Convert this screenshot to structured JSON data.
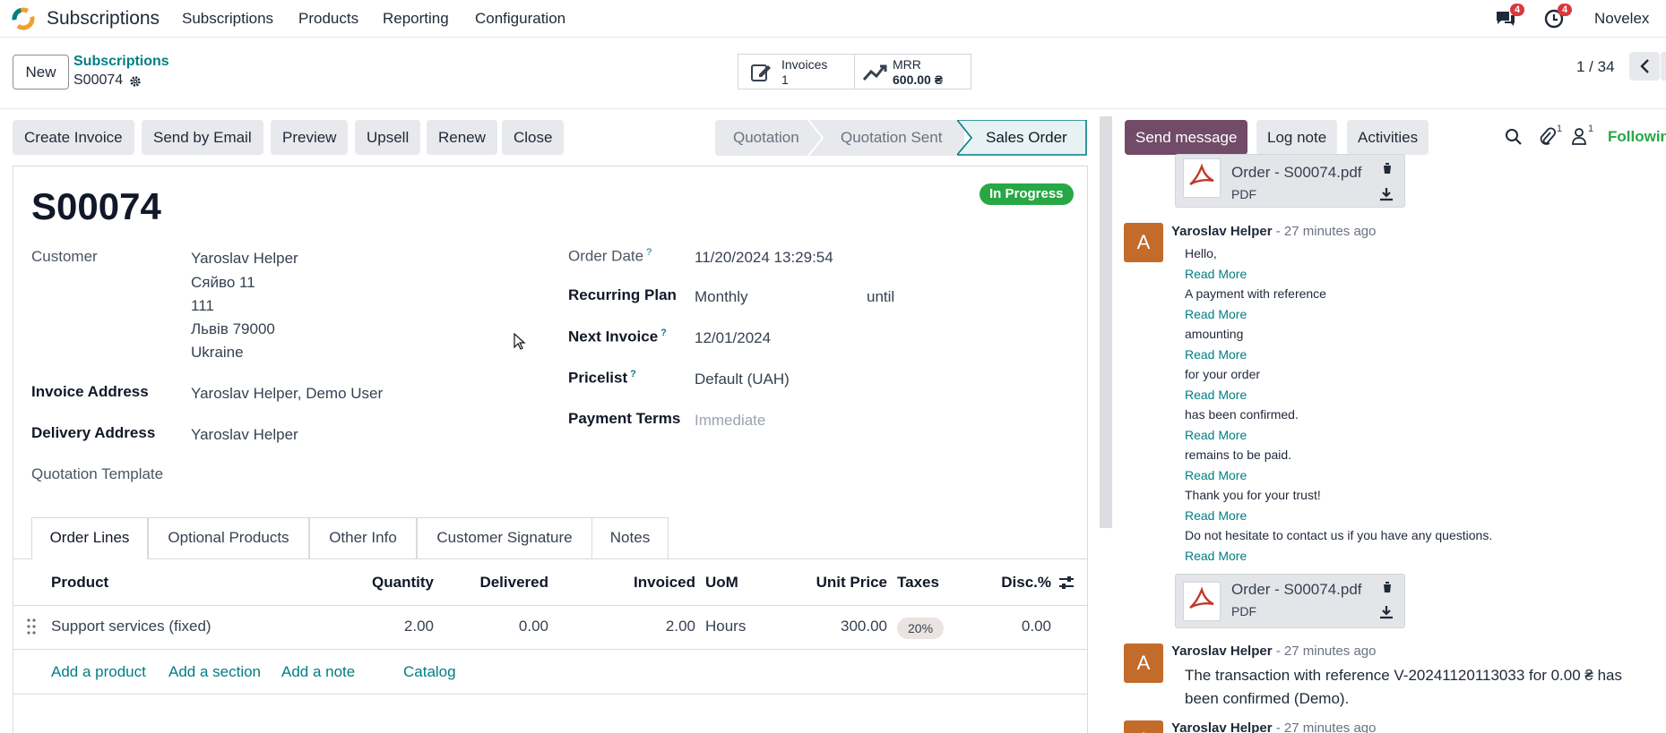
{
  "topbar": {
    "app_name": "Subscriptions",
    "menu": [
      "Subscriptions",
      "Products",
      "Reporting",
      "Configuration"
    ],
    "messages_badge": "4",
    "activities_badge": "4",
    "company": "Novelex"
  },
  "control": {
    "new_label": "New",
    "breadcrumb_parent": "Subscriptions",
    "record_name": "S00074",
    "invoices_label": "Invoices",
    "invoices_count": "1",
    "mrr_label": "MRR",
    "mrr_value": "600.00 ₴",
    "pager": "1 / 34"
  },
  "actions": [
    "Create Invoice",
    "Send by Email",
    "Preview",
    "Upsell",
    "Renew",
    "Close"
  ],
  "stages": [
    "Quotation",
    "Quotation Sent",
    "Sales Order"
  ],
  "form": {
    "title": "S00074",
    "status": "In Progress",
    "customer_label": "Customer",
    "customer_name": "Yaroslav Helper",
    "customer_address": [
      "Сяйво 11",
      "111",
      "Львів 79000",
      "Ukraine"
    ],
    "invoice_address_label": "Invoice Address",
    "invoice_address": "Yaroslav Helper, Demo User",
    "delivery_address_label": "Delivery Address",
    "delivery_address": "Yaroslav Helper",
    "quotation_template_label": "Quotation Template",
    "order_date_label": "Order Date",
    "order_date": "11/20/2024 13:29:54",
    "recurring_plan_label": "Recurring Plan",
    "recurring_plan": "Monthly",
    "until_label": "until",
    "next_invoice_label": "Next Invoice",
    "next_invoice": "12/01/2024",
    "pricelist_label": "Pricelist",
    "pricelist": "Default (UAH)",
    "payment_terms_label": "Payment Terms",
    "payment_terms": "Immediate",
    "qmark": "?"
  },
  "tabs": [
    "Order Lines",
    "Optional Products",
    "Other Info",
    "Customer Signature",
    "Notes"
  ],
  "table": {
    "headers": [
      "Product",
      "Quantity",
      "Delivered",
      "Invoiced",
      "UoM",
      "Unit Price",
      "Taxes",
      "Disc.%"
    ],
    "row": {
      "product": "Support services (fixed)",
      "quantity": "2.00",
      "delivered": "0.00",
      "invoiced": "2.00",
      "uom": "Hours",
      "unit_price": "300.00",
      "taxes": "20%",
      "disc": "0.00"
    },
    "add_links": [
      "Add a product",
      "Add a section",
      "Add a note",
      "Catalog"
    ]
  },
  "chatter": {
    "send_message": "Send message",
    "log_note": "Log note",
    "activities": "Activities",
    "attachments_count": "1",
    "followers_count": "1",
    "following": "Following",
    "attachment_name": "Order - S00074.pdf",
    "attachment_type": "PDF",
    "author": "Yaroslav Helper",
    "avatar_letter": "A",
    "time_ago": "- 27 minutes ago",
    "message_lines": [
      "Hello,",
      "A payment with reference",
      "amounting",
      "for your order",
      "has been confirmed.",
      "remains to be paid.",
      "Thank you for your trust!",
      "Do not hesitate to contact us if you have any questions."
    ],
    "read_more": "Read More",
    "transaction_line1": "The transaction with reference V-20241120113033 for 0.00 ₴ has",
    "transaction_line2": "been confirmed (Demo)."
  },
  "colors": {
    "primary": "#714b67",
    "link": "#017e84",
    "success": "#28a745",
    "badge": "#d9383b",
    "avatar": "#c26b2a"
  }
}
